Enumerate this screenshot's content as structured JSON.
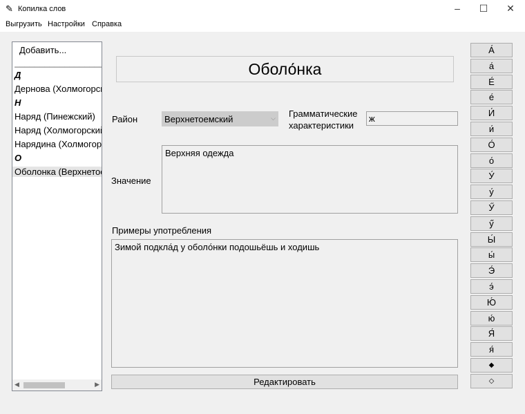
{
  "window": {
    "title": "Копилка слов"
  },
  "menu": [
    "Выгрузить",
    "Настройки",
    "Справка"
  ],
  "list": {
    "add": "Добавить...",
    "separator": "____________________",
    "items": [
      {
        "text": "Д",
        "header": true
      },
      {
        "text": "Дернова (Холмогорский)",
        "header": false
      },
      {
        "text": "Н",
        "header": true
      },
      {
        "text": "Наряд (Пинежский)",
        "header": false
      },
      {
        "text": "Наряд (Холмогорский)",
        "header": false
      },
      {
        "text": "Нарядина (Холмогорский)",
        "header": false
      },
      {
        "text": "О",
        "header": true
      },
      {
        "text": "Оболонка (Верхнетоемский)",
        "header": false,
        "selected": true
      }
    ]
  },
  "word": "Оболо́нка",
  "district": {
    "label": "Район",
    "value": "Верхнетоемский"
  },
  "grammar": {
    "label1": "Грамматические",
    "label2": "характеристики",
    "value": "ж"
  },
  "meaning": {
    "label": "Значение",
    "value": "Верхняя одежда"
  },
  "examples": {
    "label": "Примеры употребления",
    "value": "Зимой подкла́д у оболо́нки подошьёшь и ходишь"
  },
  "edit_button": "Редактировать",
  "chars": [
    "А́",
    "а́",
    "Е́",
    "е́",
    "И́",
    "и́",
    "О́",
    "о́",
    "У́",
    "у́",
    "Ӳ",
    "ӳ",
    "Ы́",
    "ы́",
    "Э́",
    "э́",
    "Ю́",
    "ю́",
    "Я́",
    "я́",
    "◆",
    "◇"
  ]
}
